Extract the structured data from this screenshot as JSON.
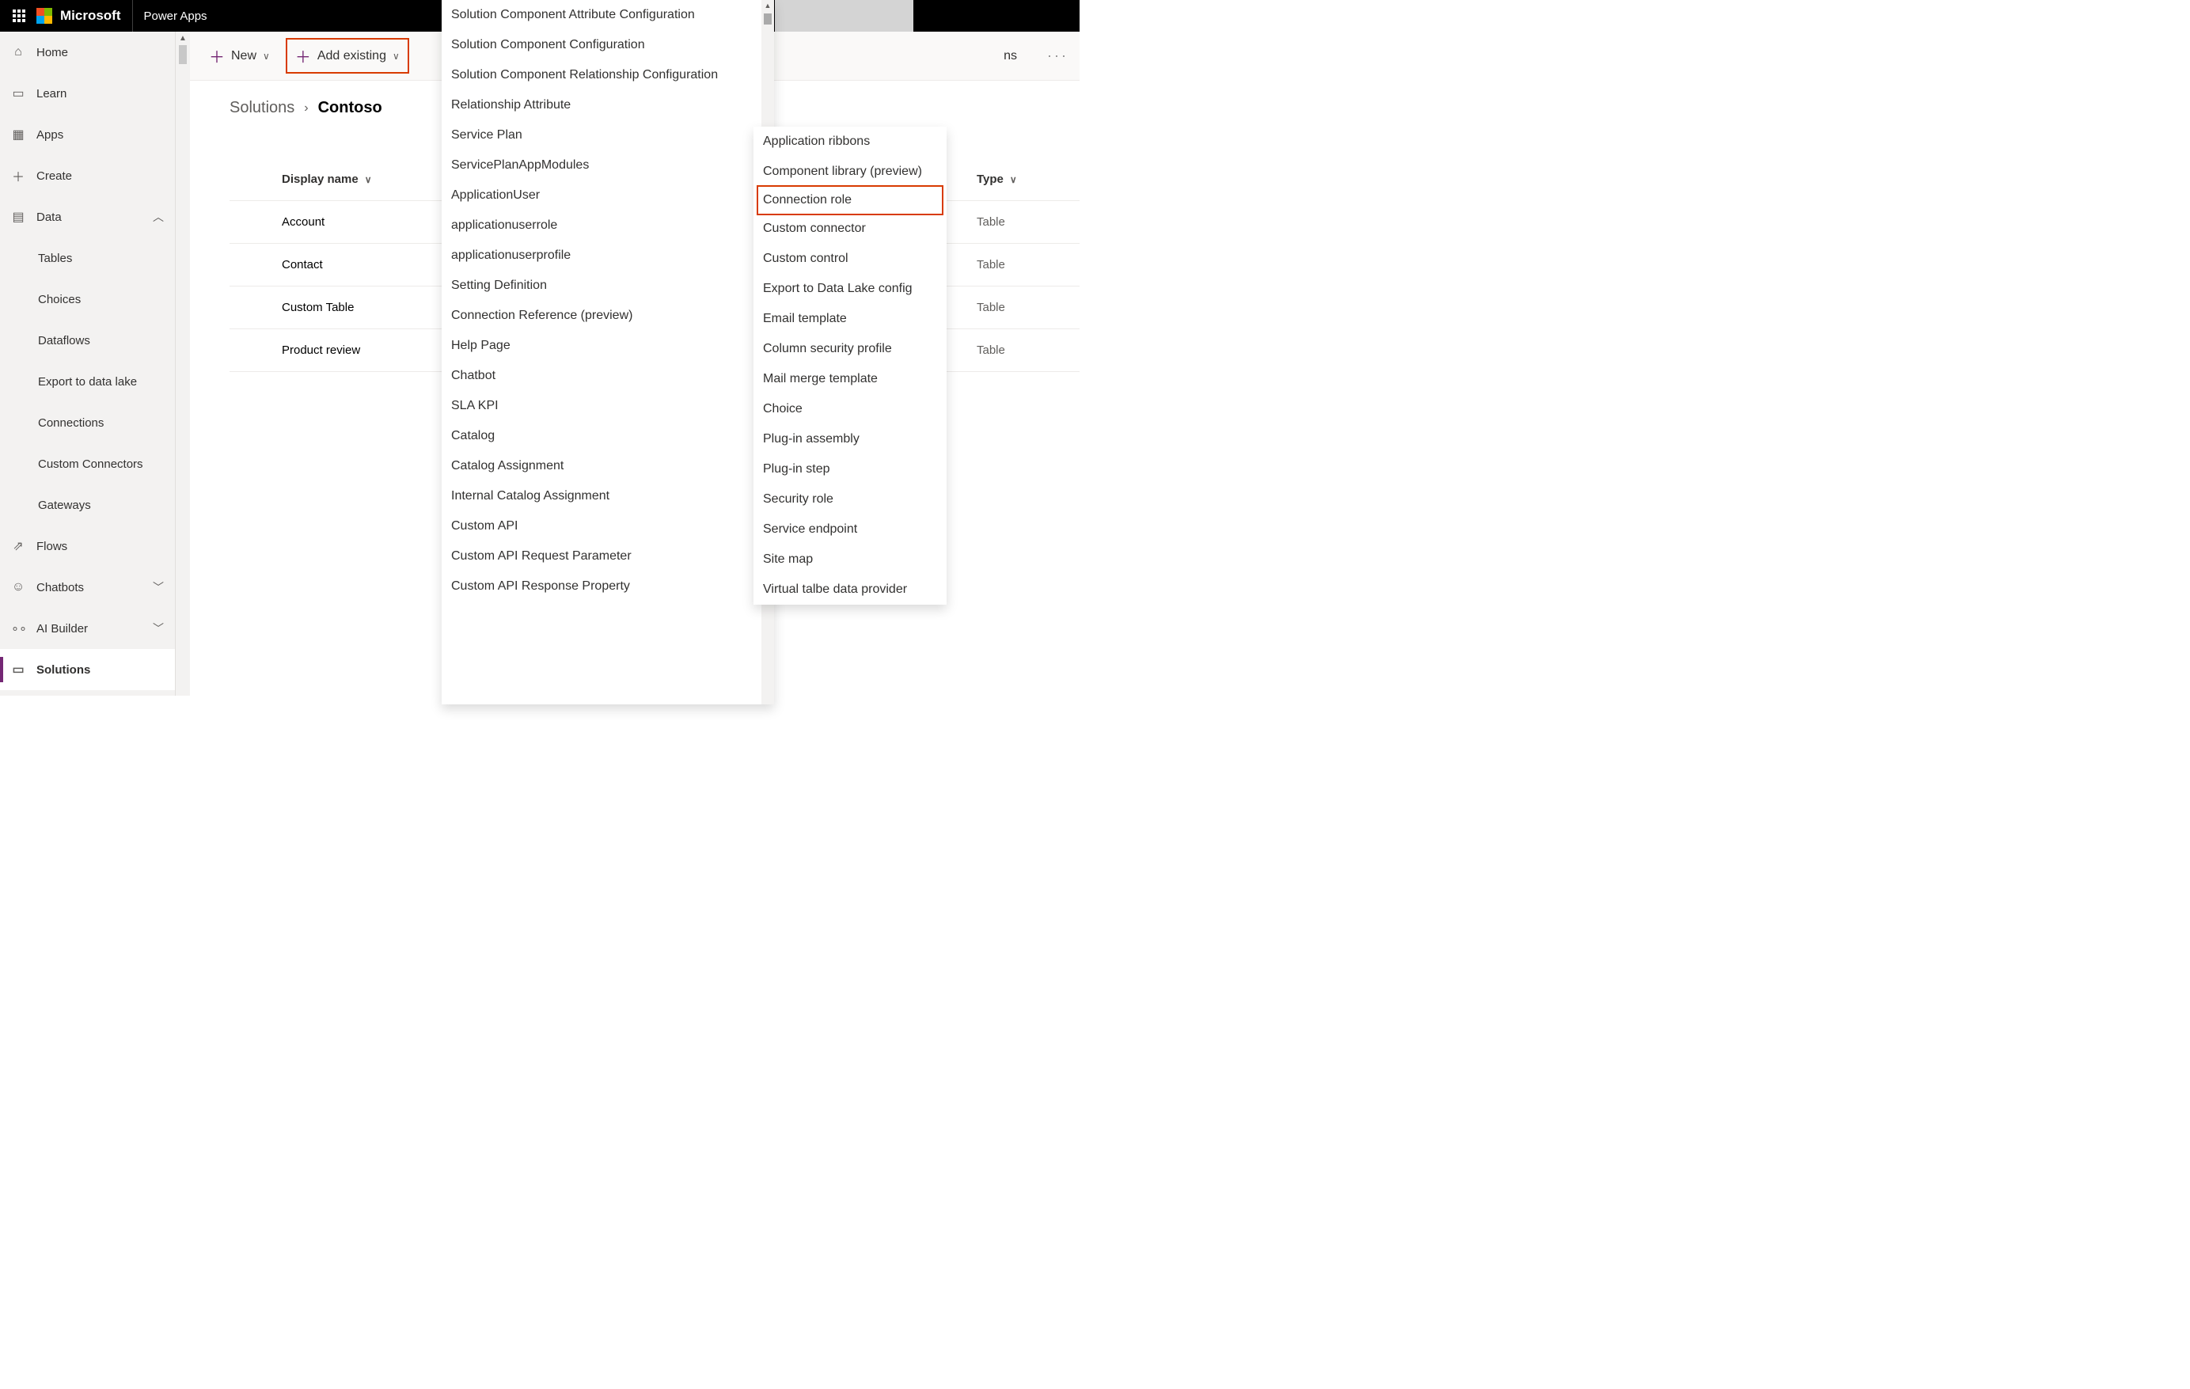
{
  "header": {
    "brand": "Microsoft",
    "app": "Power Apps"
  },
  "nav": [
    {
      "icon": "⌂",
      "label": "Home"
    },
    {
      "icon": "▭",
      "label": "Learn"
    },
    {
      "icon": "▦",
      "label": "Apps"
    },
    {
      "icon": "＋",
      "label": "Create"
    },
    {
      "icon": "▤",
      "label": "Data",
      "chev": "︿"
    },
    {
      "sub": true,
      "label": "Tables"
    },
    {
      "sub": true,
      "label": "Choices"
    },
    {
      "sub": true,
      "label": "Dataflows"
    },
    {
      "sub": true,
      "label": "Export to data lake"
    },
    {
      "sub": true,
      "label": "Connections"
    },
    {
      "sub": true,
      "label": "Custom Connectors"
    },
    {
      "sub": true,
      "label": "Gateways"
    },
    {
      "icon": "⇗",
      "label": "Flows"
    },
    {
      "icon": "☺",
      "label": "Chatbots",
      "chev": "﹀"
    },
    {
      "icon": "∘∘",
      "label": "AI Builder",
      "chev": "﹀"
    },
    {
      "icon": "▭",
      "label": "Solutions",
      "sel": true
    }
  ],
  "commands": {
    "new": "New",
    "add_existing": "Add existing",
    "trail": "ns"
  },
  "breadcrumb": {
    "root": "Solutions",
    "current": "Contoso"
  },
  "columns": {
    "name": "Display name",
    "type": "Type"
  },
  "rows": [
    {
      "name": "Account",
      "type": "Table"
    },
    {
      "name": "Contact",
      "type": "Table"
    },
    {
      "name": "Custom Table",
      "type": "Table"
    },
    {
      "name": "Product review",
      "type": "Table"
    }
  ],
  "menu1": [
    "Solution Component Attribute Configuration",
    "Solution Component Configuration",
    "Solution Component Relationship Configuration",
    "Relationship Attribute",
    "Service Plan",
    "ServicePlanAppModules",
    "ApplicationUser",
    "applicationuserrole",
    "applicationuserprofile",
    "Setting Definition",
    "Connection Reference (preview)",
    "Help Page",
    "Chatbot",
    "SLA KPI",
    "Catalog",
    "Catalog Assignment",
    "Internal Catalog Assignment",
    "Custom API",
    "Custom API Request Parameter",
    "Custom API Response Property"
  ],
  "menu2": [
    {
      "label": "Application ribbons"
    },
    {
      "label": "Component library (preview)"
    },
    {
      "label": "Connection role",
      "hl": true
    },
    {
      "label": "Custom connector"
    },
    {
      "label": "Custom control"
    },
    {
      "label": "Export to Data Lake config"
    },
    {
      "label": "Email template"
    },
    {
      "label": "Column security profile"
    },
    {
      "label": "Mail merge template"
    },
    {
      "label": "Choice"
    },
    {
      "label": "Plug-in assembly"
    },
    {
      "label": "Plug-in step"
    },
    {
      "label": "Security role"
    },
    {
      "label": "Service endpoint"
    },
    {
      "label": "Site map"
    },
    {
      "label": "Virtual talbe data provider"
    }
  ]
}
